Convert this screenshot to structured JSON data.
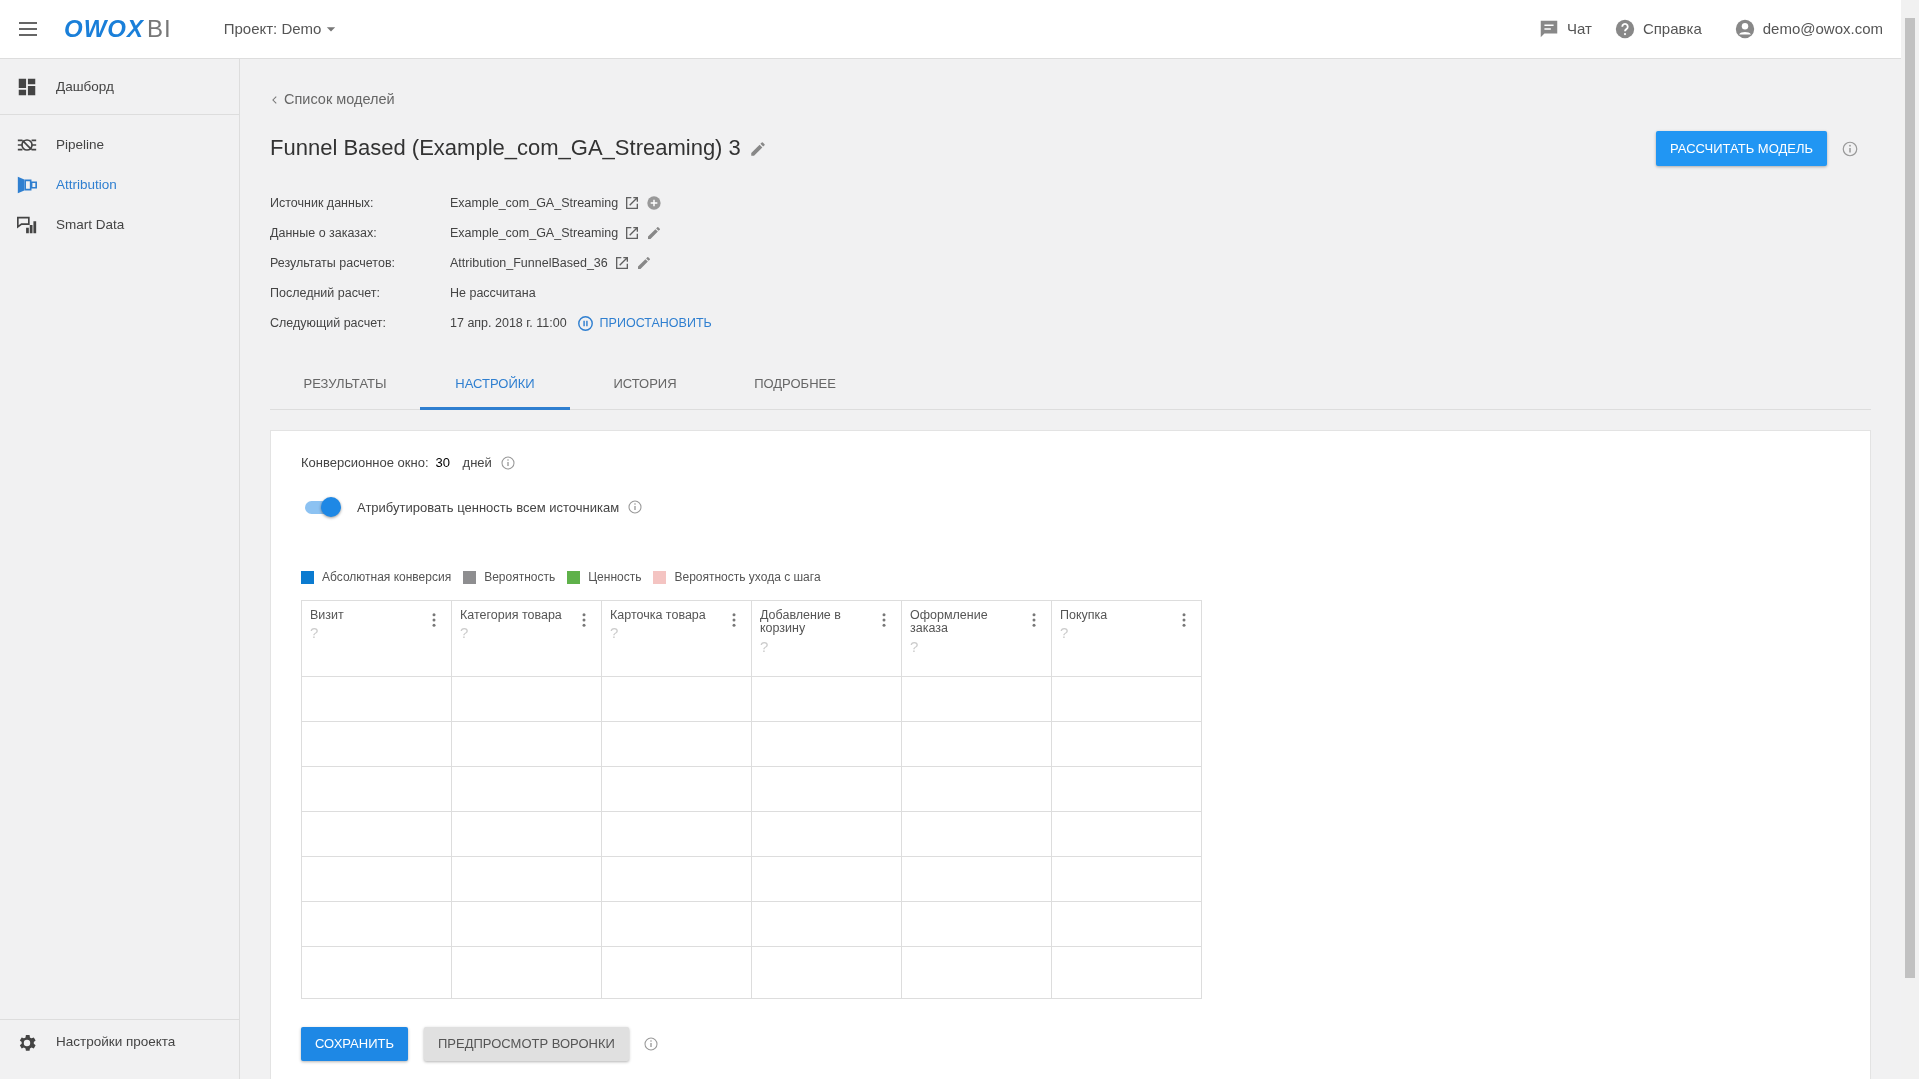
{
  "header": {
    "logo": {
      "brand": "OWOX",
      "suffix": "BI"
    },
    "project": "Проект: Demo",
    "links": [
      {
        "kind": "chat",
        "label": "Чат"
      },
      {
        "kind": "help",
        "label": "Справка"
      },
      {
        "kind": "account",
        "label": "demo@owox.com"
      }
    ]
  },
  "sidebar": {
    "groups": [
      {
        "items": [
          {
            "kind": "dashboard",
            "label": "Дашборд",
            "selected": false
          }
        ]
      },
      {
        "items": [
          {
            "kind": "pipeline",
            "label": "Pipeline",
            "selected": false
          },
          {
            "kind": "attribution",
            "label": "Attribution",
            "selected": true
          },
          {
            "kind": "smartdata",
            "label": "Smart Data",
            "selected": false
          }
        ]
      }
    ],
    "footer": {
      "kind": "gear",
      "label": "Настройки проекта"
    }
  },
  "breadcrumb": "Список моделей",
  "title": "Funnel Based (Example_com_GA_Streaming) 3",
  "calc_button": "РАССЧИТАТЬ МОДЕЛЬ",
  "info": [
    {
      "label": "Источник данных:",
      "value": "Example_com_GA_Streaming",
      "actions": [
        {
          "kind": "external"
        },
        {
          "kind": "add"
        }
      ]
    },
    {
      "label": "Данные о заказах:",
      "value": "Example_com_GA_Streaming",
      "actions": [
        {
          "kind": "external"
        },
        {
          "kind": "edit"
        }
      ]
    },
    {
      "label": "Результаты расчетов:",
      "value": "Attribution_FunnelBased_36",
      "actions": [
        {
          "kind": "external"
        },
        {
          "kind": "edit"
        }
      ]
    },
    {
      "label": "Последний расчет:",
      "value": "Не рассчитана"
    },
    {
      "label": "Следующий расчет:",
      "value": "17 апр. 2018 г. 11:00",
      "link": "ПРИОСТАНОВИТЬ"
    }
  ],
  "tabs": [
    {
      "label": "РЕЗУЛЬТАТЫ",
      "selected": false
    },
    {
      "label": "НАСТРОЙКИ",
      "selected": true
    },
    {
      "label": "ИСТОРИЯ",
      "selected": false
    },
    {
      "label": "ПОДРОБНЕЕ",
      "selected": false
    }
  ],
  "settings": {
    "conversion_window": {
      "label": "Конверсионное окно:",
      "value": "30",
      "unit": "дней"
    },
    "toggle": {
      "label": "Атрибутировать ценность всем источникам",
      "on": true
    },
    "legend": [
      {
        "label": "Абсолютная конверсия",
        "color": "#0b7bd0"
      },
      {
        "label": "Вероятность",
        "color": "#8e8e90"
      },
      {
        "label": "Ценность",
        "color": "#5fb14a"
      },
      {
        "label": "Вероятность ухода с шага",
        "color": "#f4c4c2"
      }
    ],
    "funnel": [
      {
        "title": "Визит",
        "hint": "?"
      },
      {
        "title": "Категория товара",
        "hint": "?"
      },
      {
        "title": "Карточка товара",
        "hint": "?"
      },
      {
        "title": "Добавление в корзину",
        "hint": "?"
      },
      {
        "title": "Оформление заказа",
        "hint": "?"
      },
      {
        "title": "Покупка",
        "hint": "?"
      }
    ]
  },
  "buttons": {
    "save": "СОХРАНИТЬ",
    "preview": "ПРЕДПРОСМОТР ВОРОНКИ"
  }
}
